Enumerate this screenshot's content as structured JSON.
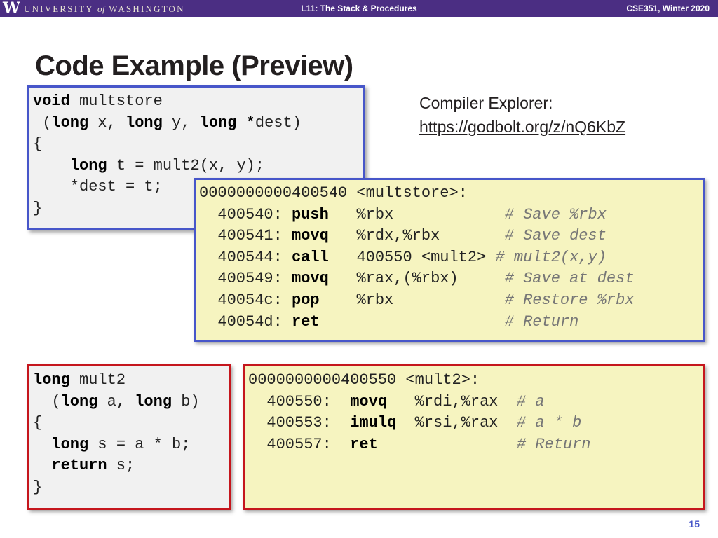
{
  "header": {
    "logo_letter": "W",
    "university_prefix": "UNIVERSITY ",
    "university_of": "of",
    "university_suffix": " WASHINGTON",
    "lecture_title": "L11: The Stack & Procedures",
    "course": "CSE351, Winter 2020"
  },
  "slide": {
    "title": "Code Example (Preview)",
    "compiler_explorer_label": "Compiler Explorer:",
    "compiler_explorer_url": "https://godbolt.org/z/nQ6KbZ",
    "page_number": "15"
  },
  "multstore_c": [
    [
      {
        "t": "void",
        "kw": true
      },
      {
        "t": " multstore"
      }
    ],
    [
      {
        "t": " ("
      },
      {
        "t": "long",
        "kw": true
      },
      {
        "t": " x, "
      },
      {
        "t": "long",
        "kw": true
      },
      {
        "t": " y, "
      },
      {
        "t": "long",
        "kw": true
      },
      {
        "t": " "
      },
      {
        "t": "*",
        "kw": true
      },
      {
        "t": "dest)"
      }
    ],
    [
      {
        "t": "{"
      }
    ],
    [
      {
        "t": "    "
      },
      {
        "t": "long",
        "kw": true
      },
      {
        "t": " t = mult2(x, y);"
      }
    ],
    [
      {
        "t": "    *dest = t;"
      }
    ],
    [
      {
        "t": "}"
      }
    ]
  ],
  "multstore_asm": [
    [
      {
        "t": "0000000000400540 <multstore>:"
      }
    ],
    [
      {
        "t": "  400540: "
      },
      {
        "t": "push",
        "kw": true
      },
      {
        "t": "   %rbx            "
      },
      {
        "t": "# Save %rbx",
        "cm": true
      }
    ],
    [
      {
        "t": "  400541: "
      },
      {
        "t": "movq",
        "kw": true
      },
      {
        "t": "   %rdx,%rbx       "
      },
      {
        "t": "# Save dest",
        "cm": true
      }
    ],
    [
      {
        "t": "  400544: "
      },
      {
        "t": "call",
        "kw": true
      },
      {
        "t": "   400550 <mult2> "
      },
      {
        "t": "# mult2(x,y)",
        "cm": true
      }
    ],
    [
      {
        "t": "  400549: "
      },
      {
        "t": "movq",
        "kw": true
      },
      {
        "t": "   %rax,(%rbx)     "
      },
      {
        "t": "# Save at dest",
        "cm": true
      }
    ],
    [
      {
        "t": "  40054c: "
      },
      {
        "t": "pop",
        "kw": true
      },
      {
        "t": "    %rbx            "
      },
      {
        "t": "# Restore %rbx",
        "cm": true
      }
    ],
    [
      {
        "t": "  40054d: "
      },
      {
        "t": "ret",
        "kw": true
      },
      {
        "t": "                    "
      },
      {
        "t": "# Return",
        "cm": true
      }
    ]
  ],
  "mult2_c": [
    [
      {
        "t": "long",
        "kw": true
      },
      {
        "t": " mult2"
      }
    ],
    [
      {
        "t": "  ("
      },
      {
        "t": "long",
        "kw": true
      },
      {
        "t": " a, "
      },
      {
        "t": "long",
        "kw": true
      },
      {
        "t": " b)"
      }
    ],
    [
      {
        "t": "{"
      }
    ],
    [
      {
        "t": "  "
      },
      {
        "t": "long",
        "kw": true
      },
      {
        "t": " s = a * b;"
      }
    ],
    [
      {
        "t": "  "
      },
      {
        "t": "return",
        "kw": true
      },
      {
        "t": " s;"
      }
    ],
    [
      {
        "t": "}"
      }
    ]
  ],
  "mult2_asm": [
    [
      {
        "t": "0000000000400550 <mult2>:"
      }
    ],
    [
      {
        "t": "  400550:  "
      },
      {
        "t": "movq",
        "kw": true
      },
      {
        "t": "   %rdi,%rax  "
      },
      {
        "t": "# a",
        "cm": true
      }
    ],
    [
      {
        "t": "  400553:  "
      },
      {
        "t": "imulq",
        "kw": true
      },
      {
        "t": "  %rsi,%rax  "
      },
      {
        "t": "# a * b",
        "cm": true
      }
    ],
    [
      {
        "t": "  400557:  "
      },
      {
        "t": "ret",
        "kw": true
      },
      {
        "t": "               "
      },
      {
        "t": "# Return",
        "cm": true
      }
    ]
  ]
}
